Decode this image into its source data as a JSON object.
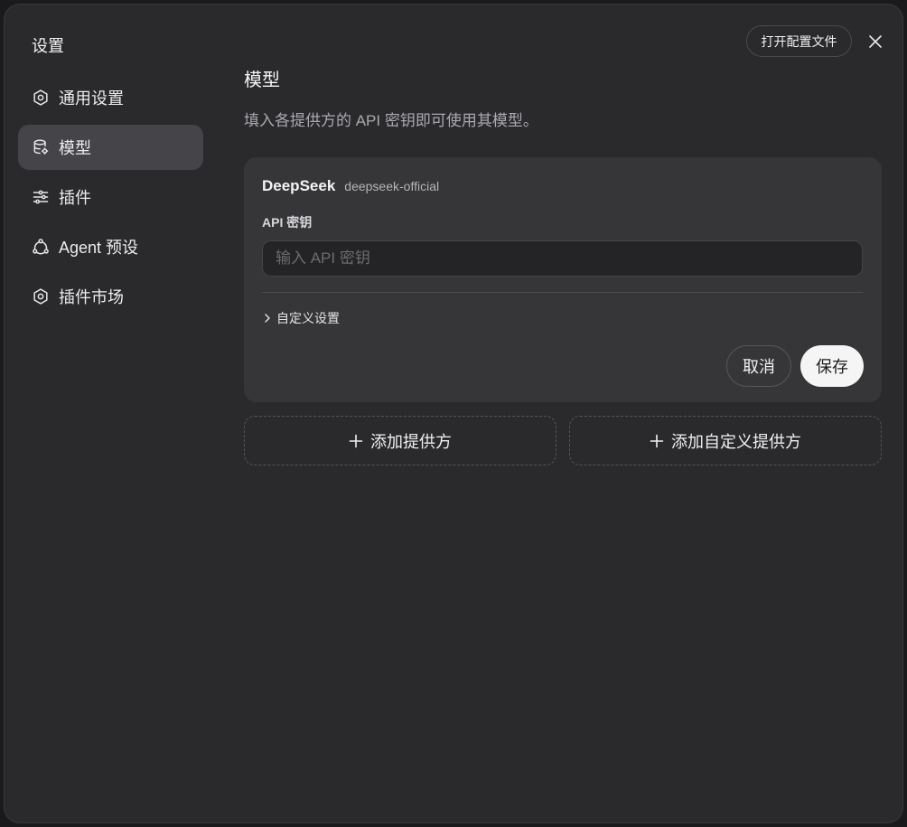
{
  "dialog": {
    "title": "设置",
    "open_config_label": "打开配置文件",
    "close_icon": "close-icon"
  },
  "sidebar": {
    "items": [
      {
        "label": "通用设置",
        "icon": "gear-icon",
        "active": false
      },
      {
        "label": "模型",
        "icon": "database-icon",
        "active": true
      },
      {
        "label": "插件",
        "icon": "sliders-icon",
        "active": false
      },
      {
        "label": "Agent 预设",
        "icon": "agent-icon",
        "active": false
      },
      {
        "label": "插件市场",
        "icon": "gear-icon",
        "active": false
      }
    ]
  },
  "main": {
    "title": "模型",
    "description": "填入各提供方的 API 密钥即可使用其模型。",
    "provider": {
      "name": "DeepSeek",
      "id": "deepseek-official",
      "api_key_label": "API 密钥",
      "api_key_value": "",
      "api_key_placeholder": "输入 API 密钥",
      "custom_settings_label": "自定义设置",
      "cancel_label": "取消",
      "save_label": "保存"
    },
    "add_provider_label": "添加提供方",
    "add_custom_provider_label": "添加自定义提供方"
  },
  "colors": {
    "background": "#2a2a2d",
    "card": "#363639",
    "active_nav": "#444449",
    "save_button": "#f5f5f5"
  }
}
